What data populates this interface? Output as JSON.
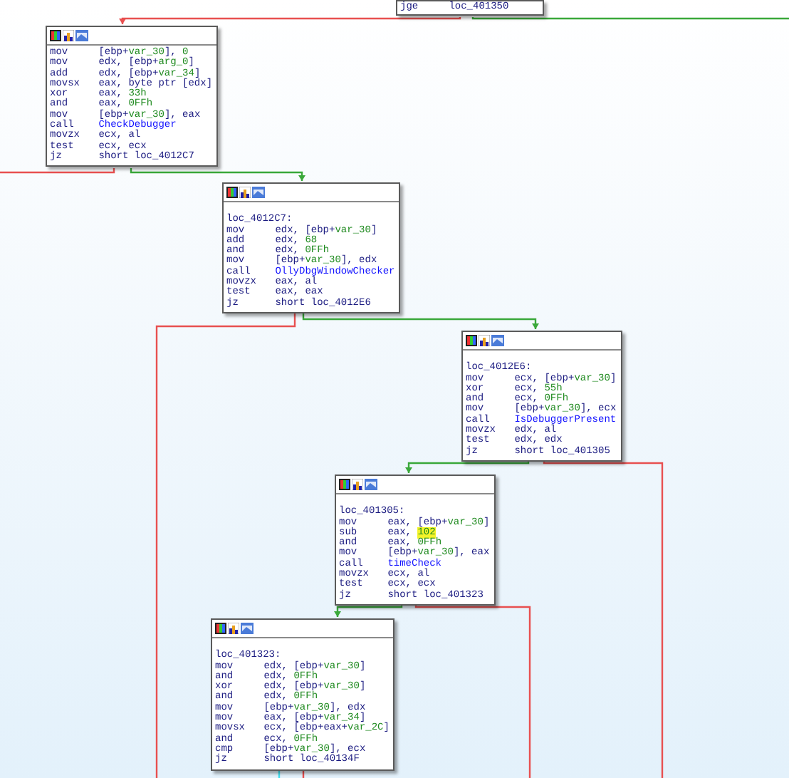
{
  "blocks": [
    {
      "kind": "cut",
      "lines": [
        {
          "op": "jge",
          "args": [
            {
              "t": "loc_401350",
              "kind": "plain"
            }
          ]
        }
      ]
    },
    {
      "kind": "node",
      "lines": [
        {
          "op": "mov",
          "args": [
            {
              "t": "[ebp+",
              "kind": "plain"
            },
            {
              "t": "var_30",
              "kind": "var"
            },
            {
              "t": "], ",
              "kind": "plain"
            },
            {
              "t": "0",
              "kind": "num"
            }
          ]
        },
        {
          "op": "mov",
          "args": [
            {
              "t": "edx, [ebp+",
              "kind": "plain"
            },
            {
              "t": "arg_0",
              "kind": "var"
            },
            {
              "t": "]",
              "kind": "plain"
            }
          ]
        },
        {
          "op": "add",
          "args": [
            {
              "t": "edx, [ebp+",
              "kind": "plain"
            },
            {
              "t": "var_34",
              "kind": "var"
            },
            {
              "t": "]",
              "kind": "plain"
            }
          ]
        },
        {
          "op": "movsx",
          "args": [
            {
              "t": "eax, byte ptr [edx]",
              "kind": "plain"
            }
          ]
        },
        {
          "op": "xor",
          "args": [
            {
              "t": "eax, ",
              "kind": "plain"
            },
            {
              "t": "33h",
              "kind": "num"
            }
          ]
        },
        {
          "op": "and",
          "args": [
            {
              "t": "eax, ",
              "kind": "plain"
            },
            {
              "t": "0FFh",
              "kind": "num"
            }
          ]
        },
        {
          "op": "mov",
          "args": [
            {
              "t": "[ebp+",
              "kind": "plain"
            },
            {
              "t": "var_30",
              "kind": "var"
            },
            {
              "t": "], eax",
              "kind": "plain"
            }
          ]
        },
        {
          "op": "call",
          "args": [
            {
              "t": "CheckDebugger",
              "kind": "func"
            }
          ]
        },
        {
          "op": "movzx",
          "args": [
            {
              "t": "ecx, al",
              "kind": "plain"
            }
          ]
        },
        {
          "op": "test",
          "args": [
            {
              "t": "ecx, ecx",
              "kind": "plain"
            }
          ]
        },
        {
          "op": "jz",
          "args": [
            {
              "t": "short loc_4012C7",
              "kind": "plain"
            }
          ]
        }
      ]
    },
    {
      "kind": "node",
      "label": "loc_4012C7:",
      "lines": [
        {
          "op": "mov",
          "args": [
            {
              "t": "edx, [ebp+",
              "kind": "plain"
            },
            {
              "t": "var_30",
              "kind": "var"
            },
            {
              "t": "]",
              "kind": "plain"
            }
          ]
        },
        {
          "op": "add",
          "args": [
            {
              "t": "edx, ",
              "kind": "plain"
            },
            {
              "t": "68",
              "kind": "num"
            }
          ]
        },
        {
          "op": "and",
          "args": [
            {
              "t": "edx, ",
              "kind": "plain"
            },
            {
              "t": "0FFh",
              "kind": "num"
            }
          ]
        },
        {
          "op": "mov",
          "args": [
            {
              "t": "[ebp+",
              "kind": "plain"
            },
            {
              "t": "var_30",
              "kind": "var"
            },
            {
              "t": "], edx",
              "kind": "plain"
            }
          ]
        },
        {
          "op": "call",
          "args": [
            {
              "t": "OllyDbgWindowChecker",
              "kind": "func"
            }
          ]
        },
        {
          "op": "movzx",
          "args": [
            {
              "t": "eax, al",
              "kind": "plain"
            }
          ]
        },
        {
          "op": "test",
          "args": [
            {
              "t": "eax, eax",
              "kind": "plain"
            }
          ]
        },
        {
          "op": "jz",
          "args": [
            {
              "t": "short loc_4012E6",
              "kind": "plain"
            }
          ]
        }
      ]
    },
    {
      "kind": "node",
      "label": "loc_4012E6:",
      "lines": [
        {
          "op": "mov",
          "args": [
            {
              "t": "ecx, [ebp+",
              "kind": "plain"
            },
            {
              "t": "var_30",
              "kind": "var"
            },
            {
              "t": "]",
              "kind": "plain"
            }
          ]
        },
        {
          "op": "xor",
          "args": [
            {
              "t": "ecx, ",
              "kind": "plain"
            },
            {
              "t": "55h",
              "kind": "num"
            }
          ]
        },
        {
          "op": "and",
          "args": [
            {
              "t": "ecx, ",
              "kind": "plain"
            },
            {
              "t": "0FFh",
              "kind": "num"
            }
          ]
        },
        {
          "op": "mov",
          "args": [
            {
              "t": "[ebp+",
              "kind": "plain"
            },
            {
              "t": "var_30",
              "kind": "var"
            },
            {
              "t": "], ecx",
              "kind": "plain"
            }
          ]
        },
        {
          "op": "call",
          "args": [
            {
              "t": "IsDebuggerPresent",
              "kind": "func"
            }
          ]
        },
        {
          "op": "movzx",
          "args": [
            {
              "t": "edx, al",
              "kind": "plain"
            }
          ]
        },
        {
          "op": "test",
          "args": [
            {
              "t": "edx, edx",
              "kind": "plain"
            }
          ]
        },
        {
          "op": "jz",
          "args": [
            {
              "t": "short loc_401305",
              "kind": "plain"
            }
          ]
        }
      ]
    },
    {
      "kind": "node",
      "label": "loc_401305:",
      "lines": [
        {
          "op": "mov",
          "args": [
            {
              "t": "eax, [ebp+",
              "kind": "plain"
            },
            {
              "t": "var_30",
              "kind": "var"
            },
            {
              "t": "]",
              "kind": "plain"
            }
          ]
        },
        {
          "op": "sub",
          "args": [
            {
              "t": "eax, ",
              "kind": "plain"
            },
            {
              "t": "102",
              "kind": "highlight"
            }
          ]
        },
        {
          "op": "and",
          "args": [
            {
              "t": "eax, ",
              "kind": "plain"
            },
            {
              "t": "0FFh",
              "kind": "num"
            }
          ]
        },
        {
          "op": "mov",
          "args": [
            {
              "t": "[ebp+",
              "kind": "plain"
            },
            {
              "t": "var_30",
              "kind": "var"
            },
            {
              "t": "], eax",
              "kind": "plain"
            }
          ]
        },
        {
          "op": "call",
          "args": [
            {
              "t": "timeCheck",
              "kind": "func"
            }
          ]
        },
        {
          "op": "movzx",
          "args": [
            {
              "t": "ecx, al",
              "kind": "plain"
            }
          ]
        },
        {
          "op": "test",
          "args": [
            {
              "t": "ecx, ecx",
              "kind": "plain"
            }
          ]
        },
        {
          "op": "jz",
          "args": [
            {
              "t": "short loc_401323",
              "kind": "plain"
            }
          ]
        }
      ]
    },
    {
      "kind": "node",
      "label": "loc_401323:",
      "lines": [
        {
          "op": "mov",
          "args": [
            {
              "t": "edx, [ebp+",
              "kind": "plain"
            },
            {
              "t": "var_30",
              "kind": "var"
            },
            {
              "t": "]",
              "kind": "plain"
            }
          ]
        },
        {
          "op": "and",
          "args": [
            {
              "t": "edx, ",
              "kind": "plain"
            },
            {
              "t": "0FFh",
              "kind": "num"
            }
          ]
        },
        {
          "op": "xor",
          "args": [
            {
              "t": "edx, [ebp+",
              "kind": "plain"
            },
            {
              "t": "var_30",
              "kind": "var"
            },
            {
              "t": "]",
              "kind": "plain"
            }
          ]
        },
        {
          "op": "and",
          "args": [
            {
              "t": "edx, ",
              "kind": "plain"
            },
            {
              "t": "0FFh",
              "kind": "num"
            }
          ]
        },
        {
          "op": "mov",
          "args": [
            {
              "t": "[ebp+",
              "kind": "plain"
            },
            {
              "t": "var_30",
              "kind": "var"
            },
            {
              "t": "], edx",
              "kind": "plain"
            }
          ]
        },
        {
          "op": "mov",
          "args": [
            {
              "t": "eax, [ebp+",
              "kind": "plain"
            },
            {
              "t": "var_34",
              "kind": "var"
            },
            {
              "t": "]",
              "kind": "plain"
            }
          ]
        },
        {
          "op": "movsx",
          "args": [
            {
              "t": "ecx, [ebp+eax+",
              "kind": "plain"
            },
            {
              "t": "var_2C",
              "kind": "var"
            },
            {
              "t": "]",
              "kind": "plain"
            }
          ]
        },
        {
          "op": "and",
          "args": [
            {
              "t": "ecx, ",
              "kind": "plain"
            },
            {
              "t": "0FFh",
              "kind": "num"
            }
          ]
        },
        {
          "op": "cmp",
          "args": [
            {
              "t": "[ebp+",
              "kind": "plain"
            },
            {
              "t": "var_30",
              "kind": "var"
            },
            {
              "t": "], ecx",
              "kind": "plain"
            }
          ]
        },
        {
          "op": "jz",
          "args": [
            {
              "t": "short loc_40134F",
              "kind": "plain"
            }
          ]
        }
      ]
    }
  ]
}
